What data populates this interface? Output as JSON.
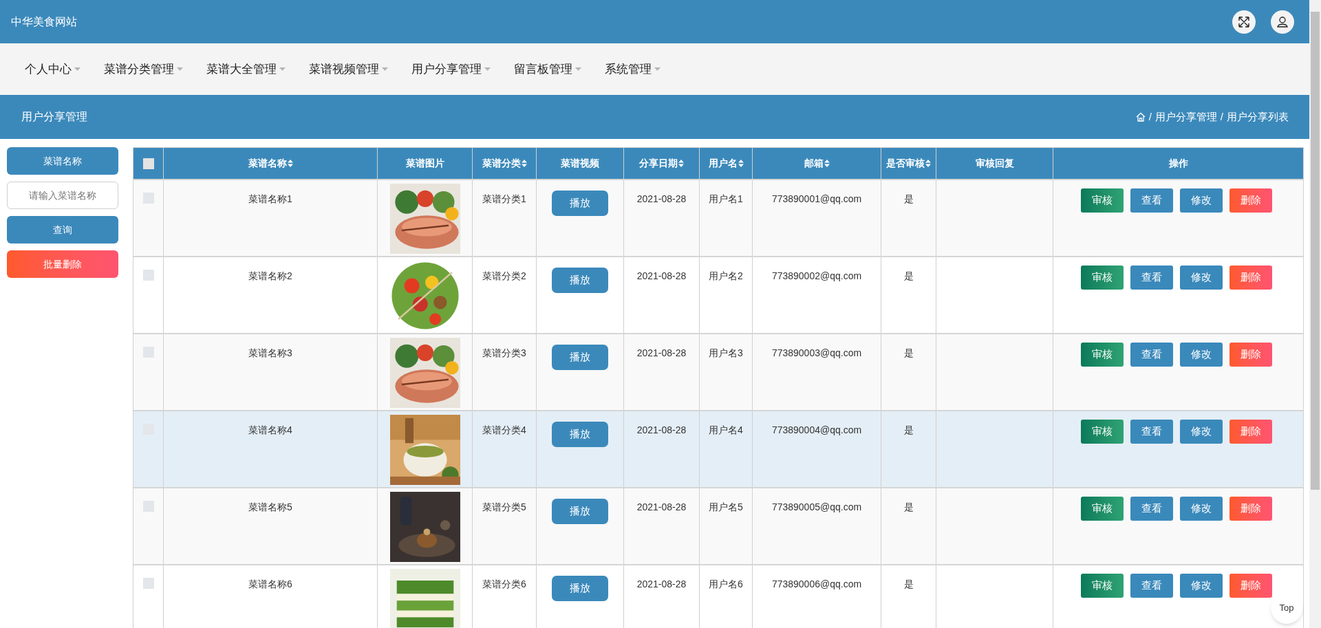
{
  "site_title": "中华美食网站",
  "nav": [
    {
      "label": "个人中心"
    },
    {
      "label": "菜谱分类管理"
    },
    {
      "label": "菜谱大全管理"
    },
    {
      "label": "菜谱视频管理"
    },
    {
      "label": "用户分享管理"
    },
    {
      "label": "留言板管理"
    },
    {
      "label": "系统管理"
    }
  ],
  "page_title": "用户分享管理",
  "breadcrumb": [
    {
      "separator": "/",
      "label": "用户分享管理"
    },
    {
      "separator": "/",
      "label": "用户分享列表"
    }
  ],
  "sidebar": {
    "field_label": "菜谱名称",
    "search": {
      "placeholder": "请输入菜谱名称"
    },
    "query_button": "查询",
    "batch_delete_button": "批量删除"
  },
  "table": {
    "select_all_checked": false,
    "columns": [
      {
        "label": "菜谱名称",
        "sortable": true
      },
      {
        "label": "菜谱图片",
        "sortable": false
      },
      {
        "label": "菜谱分类",
        "sortable": true
      },
      {
        "label": "菜谱视频",
        "sortable": false
      },
      {
        "label": "分享日期",
        "sortable": true
      },
      {
        "label": "用户名",
        "sortable": true
      },
      {
        "label": "邮箱",
        "sortable": true
      },
      {
        "label": "是否审核",
        "sortable": true
      },
      {
        "label": "审核回复",
        "sortable": false
      },
      {
        "label": "操作",
        "sortable": false
      }
    ],
    "rows": [
      {
        "checked": false,
        "highlighted": false,
        "name": "菜谱名称1",
        "category": "菜谱分类1",
        "video_button": "播放",
        "date": "2021-08-28",
        "user": "用户名1",
        "email": "773890001@qq.com",
        "reviewed": "是",
        "actions": [
          "审核",
          "查看",
          "修改",
          "删除"
        ]
      },
      {
        "checked": false,
        "highlighted": false,
        "name": "菜谱名称2",
        "category": "菜谱分类2",
        "video_button": "播放",
        "date": "2021-08-28",
        "user": "用户名2",
        "email": "773890002@qq.com",
        "reviewed": "是",
        "actions": [
          "审核",
          "查看",
          "修改",
          "删除"
        ]
      },
      {
        "checked": false,
        "highlighted": false,
        "name": "菜谱名称3",
        "category": "菜谱分类3",
        "video_button": "播放",
        "date": "2021-08-28",
        "user": "用户名3",
        "email": "773890003@qq.com",
        "reviewed": "是",
        "actions": [
          "审核",
          "查看",
          "修改",
          "删除"
        ]
      },
      {
        "checked": false,
        "highlighted": true,
        "name": "菜谱名称4",
        "category": "菜谱分类4",
        "video_button": "播放",
        "date": "2021-08-28",
        "user": "用户名4",
        "email": "773890004@qq.com",
        "reviewed": "是",
        "actions": [
          "审核",
          "查看",
          "修改",
          "删除"
        ]
      },
      {
        "checked": false,
        "highlighted": false,
        "name": "菜谱名称5",
        "category": "菜谱分类5",
        "video_button": "播放",
        "date": "2021-08-28",
        "user": "用户名5",
        "email": "773890005@qq.com",
        "reviewed": "是",
        "actions": [
          "审核",
          "查看",
          "修改",
          "删除"
        ]
      },
      {
        "checked": false,
        "highlighted": false,
        "name": "菜谱名称6",
        "category": "菜谱分类6",
        "video_button": "播放",
        "date": "2021-08-28",
        "user": "用户名6",
        "email": "773890006@qq.com",
        "reviewed": "是",
        "actions": [
          "审核",
          "查看",
          "修改",
          "删除"
        ]
      }
    ]
  },
  "top_button": "Top"
}
